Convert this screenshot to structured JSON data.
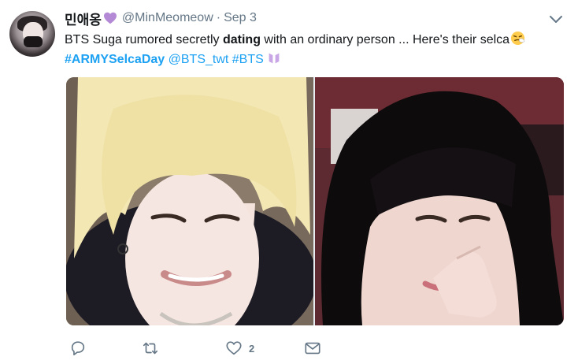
{
  "tweet": {
    "author_name": "민애옹",
    "author_badge_icon": "purple-heart",
    "handle": "@MinMeomeow",
    "separator": "·",
    "date": "Sep 3",
    "text_parts": {
      "before_bold": "BTS Suga rumored secretly ",
      "bold": "dating",
      "after_bold": " with an ordinary person ... Here's their selca",
      "emoji": "sneezing-face"
    },
    "hashtag_1": "#ARMYSelcaDay",
    "mention": "@BTS_twt",
    "hashtag_2": "#BTS",
    "hashtag_2_icon": "bts-logo",
    "media": [
      {
        "alt": "selfie-blond-man"
      },
      {
        "alt": "selfie-dark-haired-woman"
      }
    ]
  },
  "actions": {
    "reply_icon": "reply-icon",
    "retweet_icon": "retweet-icon",
    "like_icon": "like-icon",
    "like_count": "2",
    "dm_icon": "direct-message-icon"
  },
  "colors": {
    "link": "#1da1f2",
    "muted": "#657786",
    "text": "#14171a",
    "heart": "#b48ad6"
  }
}
